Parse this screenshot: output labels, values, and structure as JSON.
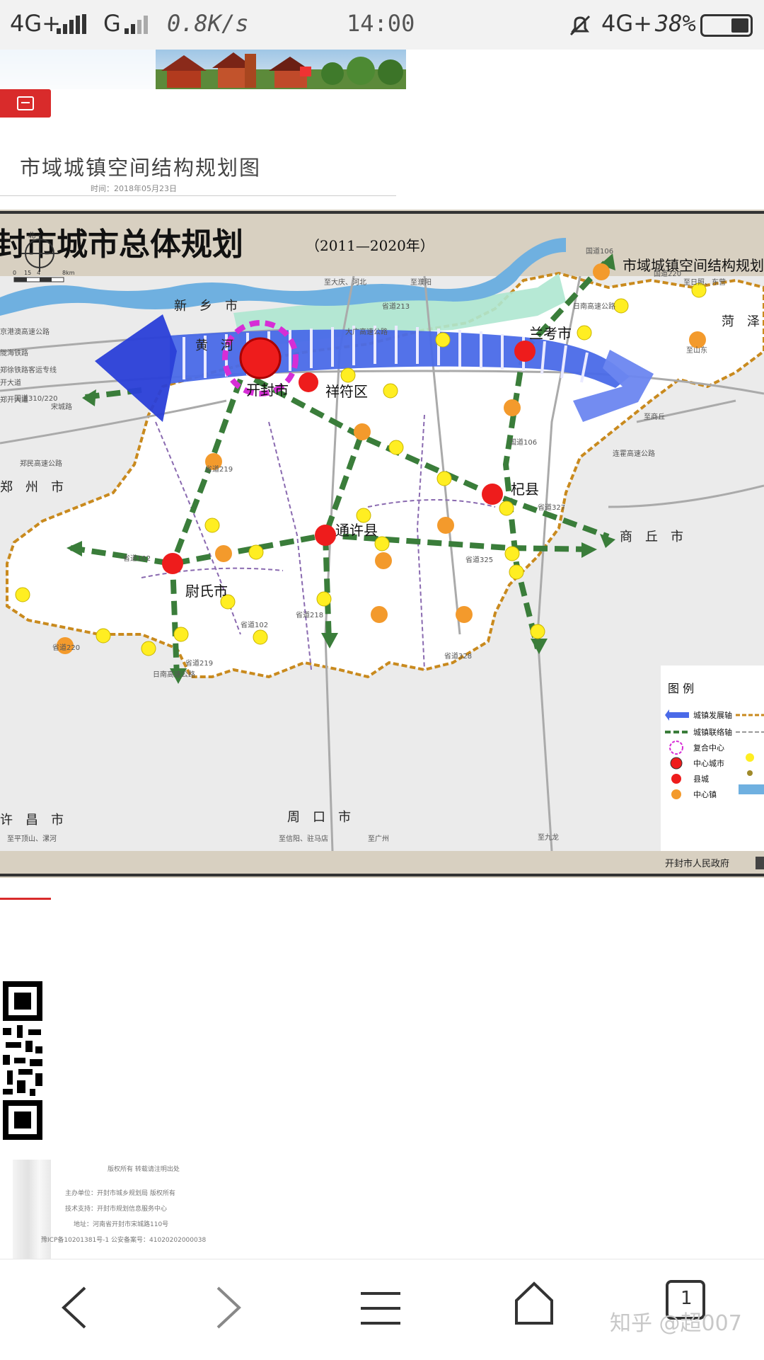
{
  "status_bar": {
    "network_1": "4G+",
    "network_2": "G",
    "speed": "0.8K/s",
    "time": "14:00",
    "network_3": "4G+",
    "battery": "38%",
    "battery_level": 0.38
  },
  "page": {
    "title": "市域城镇空间结构规划图",
    "date": "时间：2018年05月23日"
  },
  "map": {
    "header_title": "封市城市总体规划",
    "header_years": "（2011—2020年）",
    "subtitle": "市域城镇空间结构规划",
    "north": "北",
    "scale": [
      "0",
      "15",
      "4",
      "8km"
    ],
    "regions": {
      "xinxiang": "新　乡　市",
      "heze": "菏　泽",
      "zhengzhou": "郑　州　市",
      "shangqiu": "商　丘　市",
      "zhoukou": "周　口　市",
      "xuchang": "许　昌　市"
    },
    "river": "黄　河",
    "cities": {
      "kaifeng": "开封市",
      "xiangfu": "祥符区",
      "lankao": "兰考市",
      "qixian": "杞县",
      "tongxu": "通许县",
      "weishi": "尉氏市"
    },
    "road_labels": {
      "r1": "国道106",
      "r2": "国道220",
      "r3": "至大庆、河北",
      "r4": "至濮阳",
      "r5": "至日照、东营",
      "r6": "省道213",
      "r7": "大广高速公路",
      "r8": "日南高速公路",
      "r9": "省道327",
      "r10": "省道102",
      "r11": "省道325",
      "r12": "省道219",
      "r13": "省道328",
      "r14": "国道106",
      "r15": "连霍高速公路",
      "r16": "郑民高速公路",
      "r17": "国道310/220",
      "r18": "至九龙",
      "r19": "至信阳、驻马店",
      "r20": "至广州",
      "r21": "至平顶山、漯河",
      "r22": "至商丘",
      "r23": "京港澳高速公路",
      "r24": "陇海铁路",
      "r25": "郑徐铁路客运专线",
      "r26": "开大道",
      "r27": "郑开大道",
      "r28": "宋城路",
      "r29": "省道220",
      "r30": "省道102",
      "r31": "省道218",
      "r32": "省道219",
      "r33": "日南高速公路",
      "r34": "至山东"
    },
    "legend": {
      "title": "图 例",
      "items": [
        "城镇发展轴",
        "城镇联络轴",
        "复合中心",
        "中心城市",
        "县城",
        "中心镇"
      ]
    },
    "footer_org": "开封市人民政府"
  },
  "footer": {
    "heading": "版权所有 转载请注明出处",
    "line1": "主办单位：开封市城乡规划局  版权所有",
    "line2": "技术支持：开封市规划信息服务中心",
    "line3": "地址：河南省开封市宋城路110号",
    "line4": "豫ICP备10201381号-1  公安备案号：41020202000038"
  },
  "watermark": "知乎 @超007",
  "colors": {
    "accent_red": "#d92b2b",
    "axis_blue": "#4a6ae8",
    "link_green": "#3a7d3a",
    "city_red": "#ee1c1c",
    "town_orange": "#f39a2c",
    "village_yellow": "#ffee22"
  },
  "icons": {
    "back": "chevron-left-icon",
    "forward": "chevron-right-icon",
    "menu": "menu-icon",
    "home": "home-icon",
    "tabs": "tabs-icon",
    "sim_signal": "signal-icon",
    "mute": "mute-icon",
    "battery": "battery-icon",
    "qr": "qr-code-icon"
  },
  "nav": {
    "tab_count": "1"
  }
}
